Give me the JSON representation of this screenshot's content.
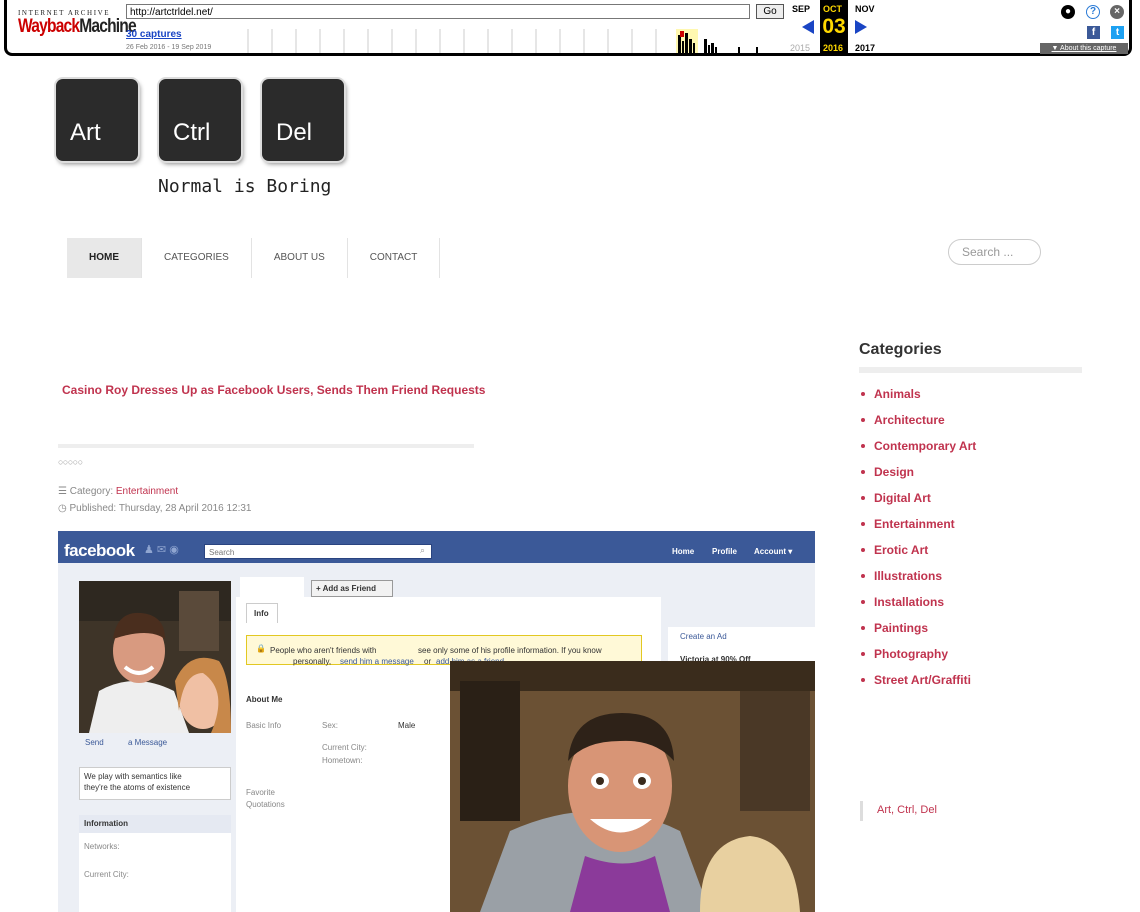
{
  "wayback": {
    "logo_top": "INTERNET ARCHIVE",
    "logo_main_1": "Wayback",
    "logo_main_2": "Machine",
    "url": "http://artctrldel.net/",
    "go_label": "Go",
    "captures_label": "30 captures",
    "captures_range": "26 Feb 2016 - 19 Sep 2019",
    "month_prev": "SEP",
    "month_cur": "OCT",
    "month_next": "NOV",
    "day": "03",
    "year_prev": "2015",
    "year_cur": "2016",
    "year_next": "2017",
    "about_label": "About this capture",
    "icons": [
      "user-icon",
      "help-icon",
      "close-icon",
      "facebook-icon",
      "twitter-icon"
    ]
  },
  "site": {
    "keys": [
      "Art",
      "Ctrl",
      "Del"
    ],
    "tagline": "Normal is Boring"
  },
  "nav": {
    "items": [
      "HOME",
      "CATEGORIES",
      "ABOUT US",
      "CONTACT"
    ],
    "active": "HOME",
    "search_placeholder": "Search ..."
  },
  "article": {
    "title": "Casino Roy Dresses Up as Facebook Users, Sends Them Friend Requests",
    "rating": "○○○○○",
    "category_label": "Category:",
    "category_value": "Entertainment",
    "published": "Published: Thursday, 28 April 2016 12:31"
  },
  "fb_image": {
    "logo": "facebook",
    "search": "Search",
    "nav": [
      "Home",
      "Profile",
      "Account ▾"
    ],
    "add_friend": "Add as Friend",
    "tab_info": "Info",
    "notice_1": "People who aren't friends with",
    "notice_1b": "see only some of his profile information. If you know",
    "notice_2a": "personally,",
    "notice_2b": "send him a message",
    "notice_2c": "or",
    "notice_2d": "add him as a friend",
    "create_ad": "Create an Ad",
    "victoria": "Victoria at 90% Off",
    "send": "Send",
    "a_message": "a Message",
    "quote_1": "We play with semantics like",
    "quote_2": "they're the atoms of existence",
    "information": "Information",
    "networks": "Networks:",
    "current_city_left": "Current City:",
    "about_me": "About Me",
    "basic_info": "Basic Info",
    "sex_label": "Sex:",
    "sex_value": "Male",
    "current_city": "Current City:",
    "hometown": "Hometown:",
    "favorite_1": "Favorite",
    "favorite_2": "Quotations"
  },
  "sidebar": {
    "heading": "Categories",
    "categories": [
      "Animals",
      "Architecture",
      "Contemporary Art",
      "Design",
      "Digital Art",
      "Entertainment",
      "Erotic Art",
      "Illustrations",
      "Installations",
      "Paintings",
      "Photography",
      "Street Art/Graffiti"
    ],
    "footer_link": "Art, Ctrl, Del"
  },
  "colors": {
    "accent": "#c0334e",
    "facebook_blue": "#3b5998",
    "wayback_link": "#1a45c4",
    "wayback_day": "#ffd800"
  }
}
